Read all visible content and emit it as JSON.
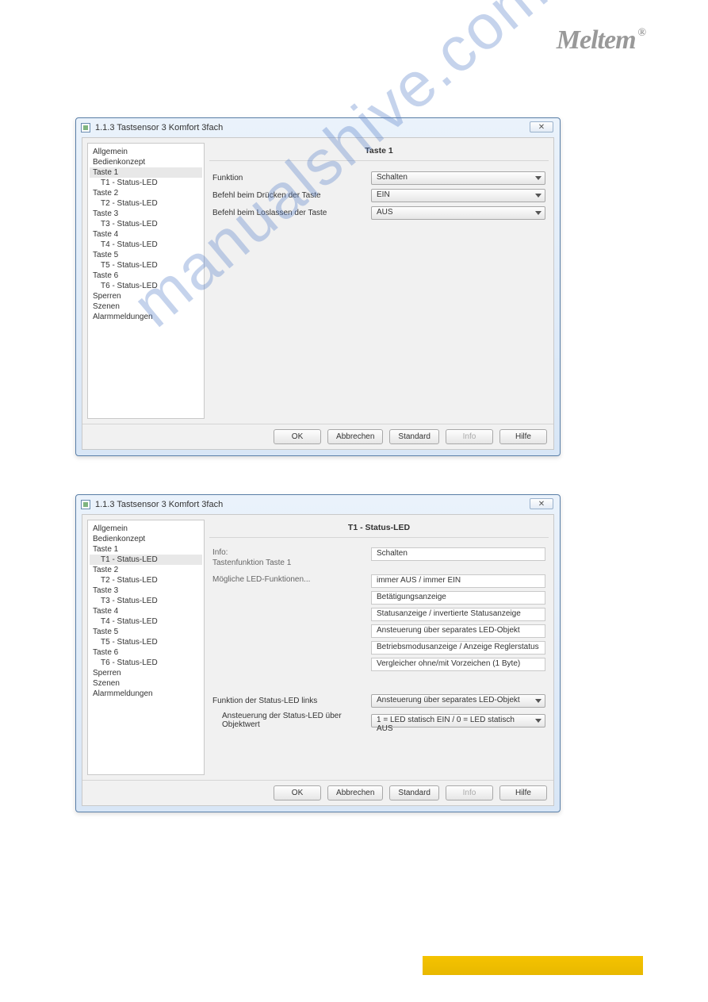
{
  "logo": {
    "text": "Meltem",
    "reg": "®"
  },
  "tree": {
    "items": [
      {
        "label": "Allgemein",
        "sub": false
      },
      {
        "label": "Bedienkonzept",
        "sub": false
      },
      {
        "label": "Taste 1",
        "sub": false
      },
      {
        "label": "T1 - Status-LED",
        "sub": true
      },
      {
        "label": "Taste 2",
        "sub": false
      },
      {
        "label": "T2 - Status-LED",
        "sub": true
      },
      {
        "label": "Taste 3",
        "sub": false
      },
      {
        "label": "T3 - Status-LED",
        "sub": true
      },
      {
        "label": "Taste 4",
        "sub": false
      },
      {
        "label": "T4 - Status-LED",
        "sub": true
      },
      {
        "label": "Taste 5",
        "sub": false
      },
      {
        "label": "T5 - Status-LED",
        "sub": true
      },
      {
        "label": "Taste 6",
        "sub": false
      },
      {
        "label": "T6 - Status-LED",
        "sub": true
      },
      {
        "label": "Sperren",
        "sub": false
      },
      {
        "label": "Szenen",
        "sub": false
      },
      {
        "label": "Alarmmeldungen",
        "sub": false
      }
    ]
  },
  "window1": {
    "title": "1.1.3 Tastsensor 3 Komfort 3fach",
    "panel_title": "Taste 1",
    "selected_tree_index": 2,
    "rows": [
      {
        "label": "Funktion",
        "value": "Schalten"
      },
      {
        "label": "Befehl beim Drücken der Taste",
        "value": "EIN"
      },
      {
        "label": "Befehl beim Loslassen der Taste",
        "value": "AUS"
      }
    ]
  },
  "window2": {
    "title": "1.1.3 Tastsensor 3 Komfort 3fach",
    "panel_title": "T1 - Status-LED",
    "selected_tree_index": 3,
    "info_label1": "Info:",
    "info_label2": "Tastenfunktion Taste 1",
    "info_value": "Schalten",
    "options_label": "Mögliche LED-Funktionen...",
    "options": [
      "immer AUS / immer EIN",
      "Betätigungsanzeige",
      "Statusanzeige / invertierte Statusanzeige",
      "Ansteuerung über separates LED-Objekt",
      "Betriebsmodusanzeige / Anzeige Reglerstatus",
      "Vergleicher ohne/mit Vorzeichen (1 Byte)"
    ],
    "rows": [
      {
        "label": "Funktion der Status-LED links",
        "value": "Ansteuerung über separates LED-Objekt"
      },
      {
        "label": "Ansteuerung der Status-LED über Objektwert",
        "value": "1 = LED statisch EIN / 0 = LED statisch AUS",
        "indent": true
      }
    ]
  },
  "buttons": {
    "ok": "OK",
    "cancel": "Abbrechen",
    "standard": "Standard",
    "info": "Info",
    "help": "Hilfe"
  },
  "watermark": "manualshive.com"
}
